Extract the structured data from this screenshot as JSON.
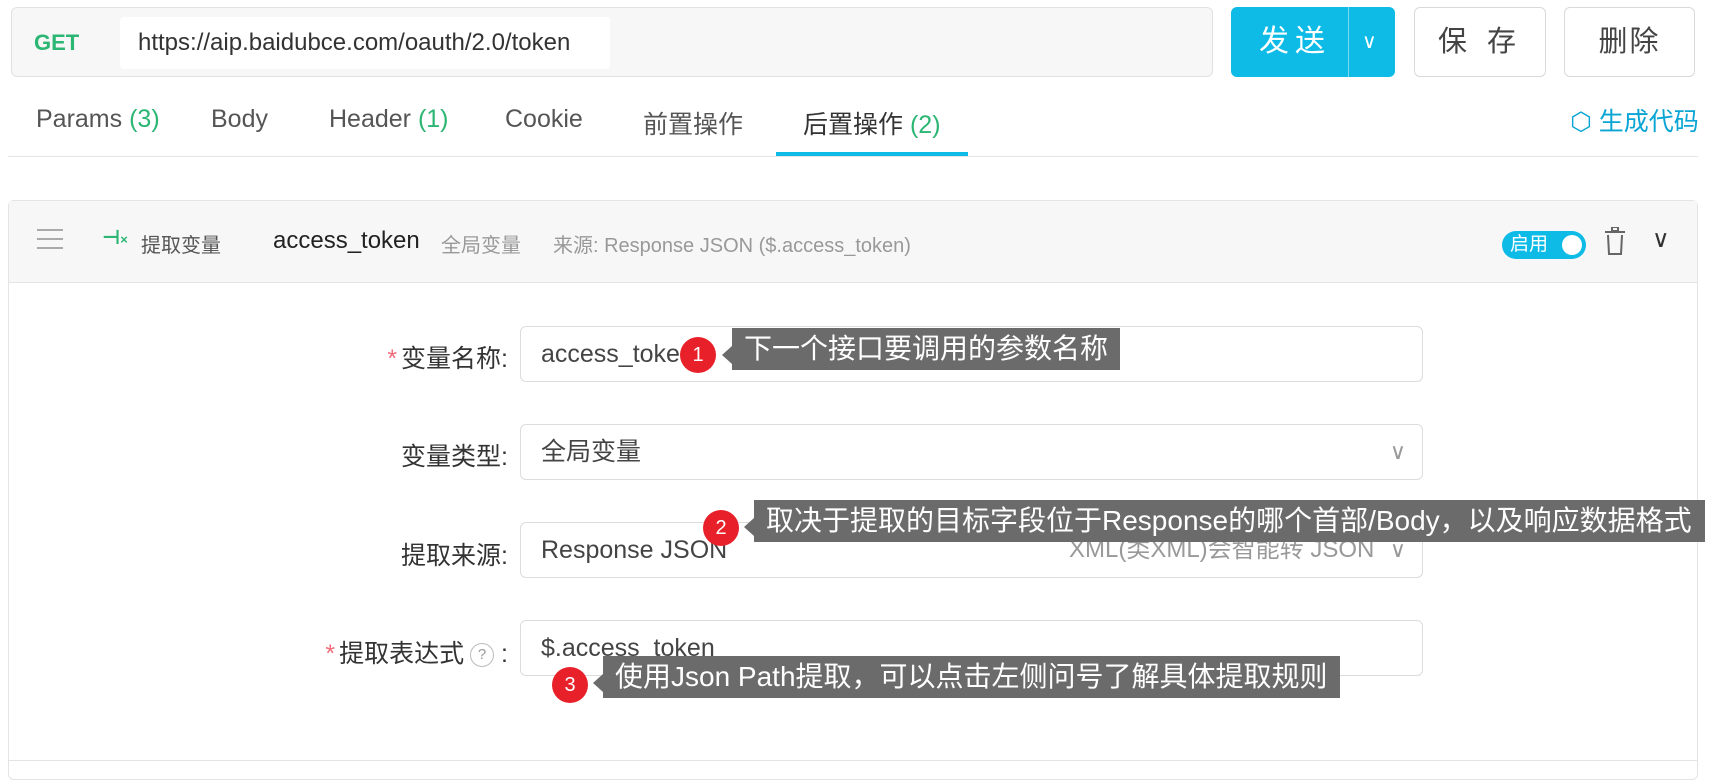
{
  "request": {
    "method": "GET",
    "url": "https://aip.baidubce.com/oauth/2.0/token",
    "send_label": "发送",
    "save_label": "保 存",
    "delete_label": "删除"
  },
  "tabs": [
    {
      "label": "Params",
      "count": "(3)"
    },
    {
      "label": "Body",
      "count": ""
    },
    {
      "label": "Header",
      "count": "(1)"
    },
    {
      "label": "Cookie",
      "count": ""
    },
    {
      "label": "前置操作",
      "count": ""
    },
    {
      "label": "后置操作",
      "count": "(2)"
    }
  ],
  "active_tab": "后置操作",
  "generate_code_label": "生成代码",
  "extract_card": {
    "type_label": "提取变量",
    "var_name": "access_token",
    "scope": "全局变量",
    "source_summary": "来源: Response JSON ($.access_token)",
    "toggle_label": "启用",
    "enabled": true
  },
  "form": {
    "var_name_label": "变量名称:",
    "var_name_value": "access_token",
    "var_type_label": "变量类型:",
    "var_type_value": "全局变量",
    "source_label": "提取来源:",
    "source_value": "Response JSON",
    "source_hint": "XML(类XML)会智能转 JSON",
    "expr_label": "提取表达式",
    "expr_colon": ":",
    "expr_value": "$.access_token",
    "help_glyph": "?"
  },
  "annotations": [
    {
      "number": "1",
      "text": "下一个接口要调用的参数名称"
    },
    {
      "number": "2",
      "text": "取决于提取的目标字段位于Response的哪个首部/Body，以及响应数据格式"
    },
    {
      "number": "3",
      "text": "使用Json Path提取，可以点击左侧问号了解具体提取规则"
    }
  ],
  "colors": {
    "accent": "#0dbbe6",
    "success": "#2bb673",
    "annotation_badge": "#e8202a",
    "annotation_bg": "#6b6b6b"
  }
}
